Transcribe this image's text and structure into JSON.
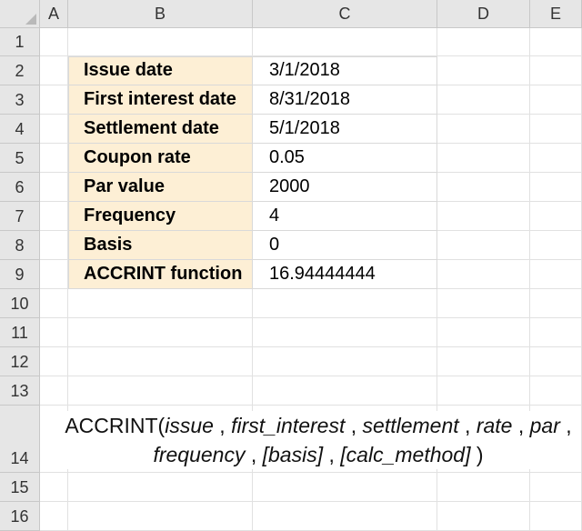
{
  "columns": [
    "A",
    "B",
    "C",
    "D",
    "E"
  ],
  "rows": [
    "1",
    "2",
    "3",
    "4",
    "5",
    "6",
    "7",
    "8",
    "9",
    "10",
    "11",
    "12",
    "13",
    "14",
    "15",
    "16"
  ],
  "table": [
    {
      "label": "Issue date",
      "value": "3/1/2018"
    },
    {
      "label": "First interest date",
      "value": "8/31/2018"
    },
    {
      "label": "Settlement date",
      "value": "5/1/2018"
    },
    {
      "label": "Coupon rate",
      "value": "0.05"
    },
    {
      "label": "Par value",
      "value": "2000"
    },
    {
      "label": "Frequency",
      "value": "4"
    },
    {
      "label": "Basis",
      "value": "0"
    },
    {
      "label": "ACCRINT function",
      "value": "16.94444444"
    }
  ],
  "syntax": {
    "func": "ACCRINT(",
    "issue": "issue",
    "sep1": " , ",
    "first_interest": "first_interest",
    "sep2": " , ",
    "settlement": "settlement",
    "sep3": " , ",
    "rate": "rate",
    "sep4": " , ",
    "par": "par",
    "sep5": " , ",
    "frequency": "frequency",
    "sep6": " , ",
    "basis": "[basis]",
    "sep7": " , ",
    "calc_method": "[calc_method]",
    "close": " )"
  },
  "colors": {
    "header_bg": "#e6e6e6",
    "label_fill": "#fdefd5",
    "gridline": "#e1e1e1"
  }
}
